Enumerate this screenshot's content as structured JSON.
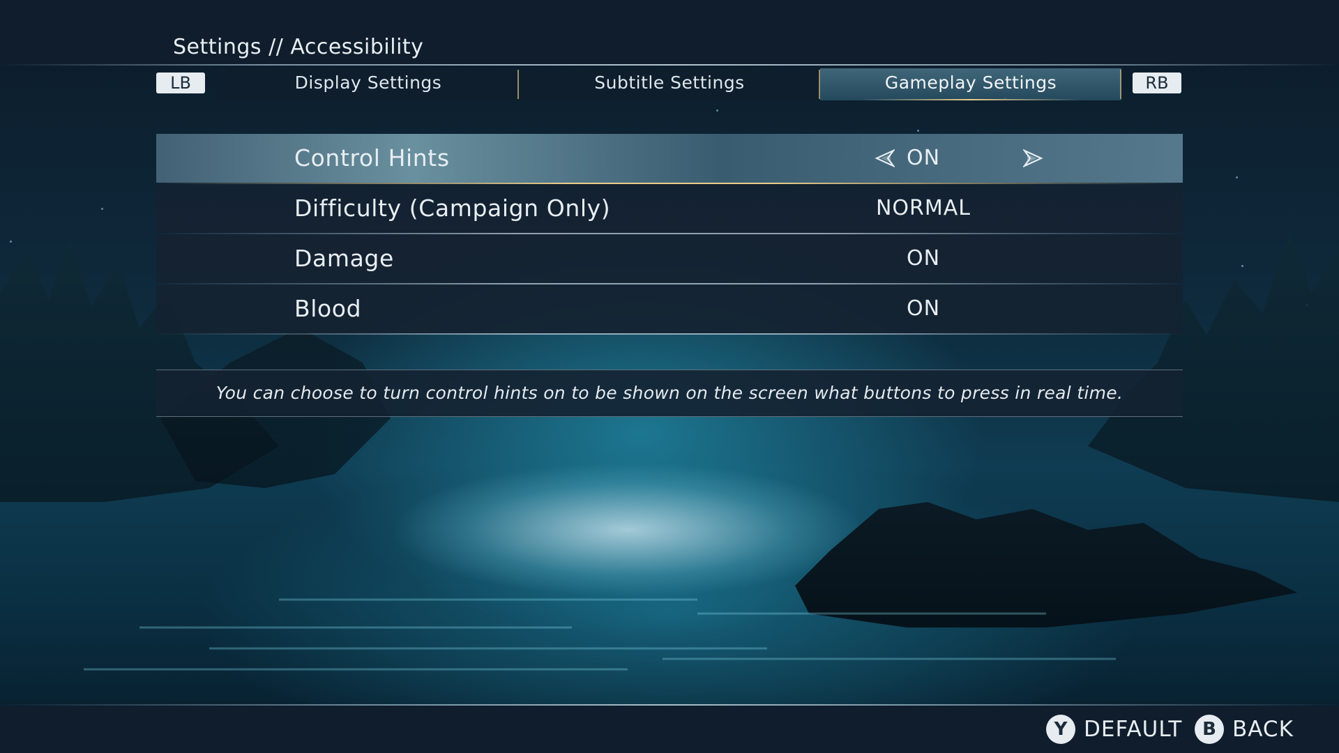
{
  "header": {
    "title": "Settings // Accessibility",
    "left_bumper": "LB",
    "right_bumper": "RB",
    "tabs": [
      {
        "label": "Display Settings",
        "active": false
      },
      {
        "label": "Subtitle Settings",
        "active": false
      },
      {
        "label": "Gameplay Settings",
        "active": true
      }
    ]
  },
  "settings": [
    {
      "label": "Control Hints",
      "value": "ON",
      "selected": true
    },
    {
      "label": "Difficulty (Campaign Only)",
      "value": "NORMAL",
      "selected": false
    },
    {
      "label": "Damage",
      "value": "ON",
      "selected": false
    },
    {
      "label": "Blood",
      "value": "ON",
      "selected": false
    }
  ],
  "description": "You can choose to turn control hints on to be shown on the screen what buttons to press in real time.",
  "footer": {
    "default_button": "Y",
    "default_label": "DEFAULT",
    "back_button": "B",
    "back_label": "BACK"
  },
  "colors": {
    "accent_gold": "#e6cd8c",
    "panel": "#142232",
    "highlight": "#6e96a5"
  }
}
